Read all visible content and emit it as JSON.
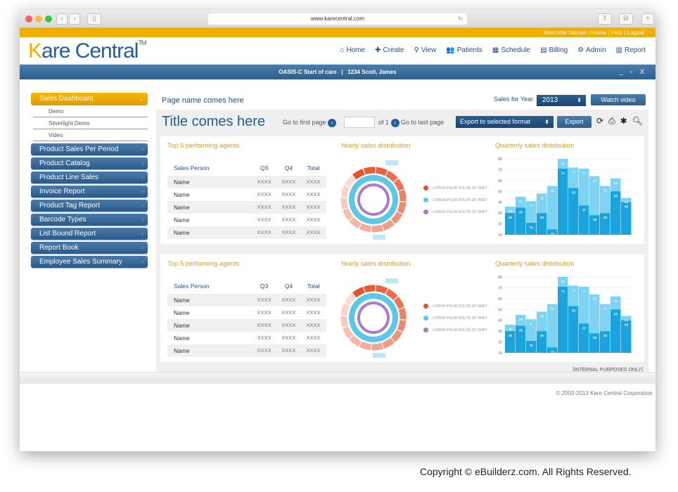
{
  "browser": {
    "url": "www.karecentral.com"
  },
  "topbar": {
    "welcome": "Welcome Naman",
    "links": [
      "Home",
      "Help",
      "Logout"
    ]
  },
  "logo": {
    "part1": "K",
    "part2": "are Central",
    "tm": "TM"
  },
  "nav": [
    {
      "icon": "home-icon",
      "glyph": "⌂",
      "label": "Home"
    },
    {
      "icon": "plus-icon",
      "glyph": "✚",
      "label": "Create"
    },
    {
      "icon": "search-icon",
      "glyph": "⚲",
      "label": "View"
    },
    {
      "icon": "users-icon",
      "glyph": "👥",
      "label": "Patients"
    },
    {
      "icon": "calendar-icon",
      "glyph": "▦",
      "label": "Schedule"
    },
    {
      "icon": "calculator-icon",
      "glyph": "▤",
      "label": "Billing"
    },
    {
      "icon": "gear-icon",
      "glyph": "⚙",
      "label": "Admin"
    },
    {
      "icon": "report-icon",
      "glyph": "▥",
      "label": "Report"
    }
  ],
  "context_bar": {
    "text": "OASIS-C Start of care   |   1234 Scott, James",
    "controls": "_ ▫ X"
  },
  "sidebar": {
    "active": "Sales Dashboard",
    "sub_items": [
      "Demo",
      "Silverlight Demo",
      "Video"
    ],
    "items": [
      "Product Sales Per Period",
      "Product Catalog",
      "Product Line Sales",
      "Invoice Report",
      "Product Tag Report",
      "Barcode Types",
      "List Bound Report",
      "Report Book",
      "Employee Sales Summary"
    ]
  },
  "page": {
    "name": "Page name comes here",
    "title": "Title comes here",
    "sales_for_year_label": "Sales for Year",
    "year": "2013",
    "watch_video": "Watch video"
  },
  "toolbar": {
    "first_page": "Go to first page",
    "of": "of 1",
    "last_page": "Go to last page",
    "export_select": "Export to selected format",
    "export": "Export"
  },
  "panels": [
    {
      "agents_title": "Top 5 performing agents",
      "yearly_title": "Yearly sales distribution",
      "quarterly_title": "Quarterly sales  distribution"
    },
    {
      "agents_title": "Top 5 performing agents",
      "yearly_title": "Yearly sales distribution",
      "quarterly_title": "Quarterly sales  distribution"
    }
  ],
  "table": {
    "headers": [
      "Sales Person",
      "Q3",
      "Q4",
      "Total"
    ],
    "rows": [
      [
        "Name",
        "XXXX",
        "XXXX",
        "XXXX"
      ],
      [
        "Name",
        "XXXX",
        "XXXX",
        "XXXX"
      ],
      [
        "Name",
        "XXXX",
        "XXXX",
        "XXXX"
      ],
      [
        "Name",
        "XXXX",
        "XXXX",
        "XXXX"
      ],
      [
        "Name",
        "XXXX",
        "XXXX",
        "XXXX"
      ]
    ]
  },
  "legend": [
    {
      "label": "LOREM IPSUM DOLOR SIT AMET",
      "color": "#e8502a"
    },
    {
      "label": "LOREM IPSUM DOLOR SIT AMET",
      "color": "#5bc8ea"
    },
    {
      "label": "LOREM IPSUM DOLOR SIT AMET",
      "color": "#a77bd0"
    }
  ],
  "chart_data": {
    "type": "bar",
    "yticks": [
      10,
      20,
      30,
      40,
      50,
      60,
      70,
      80
    ],
    "ylim": [
      10,
      80
    ],
    "series": [
      {
        "values": [
          30,
          35,
          21,
          30,
          15,
          71,
          53,
          37,
          28,
          30,
          50,
          40
        ],
        "color": "#1aa3dc"
      },
      {
        "values": [
          36,
          45,
          41,
          48,
          55,
          80,
          72,
          71,
          64,
          55,
          62,
          44
        ],
        "color": "#7fd3f2"
      }
    ]
  },
  "internal_note": "[INTERNAL PURPOSES ONLY]",
  "footer": {
    "copyright": "© 2003-2013 Kare Central Corporation"
  },
  "watermark": "Copyright © eBuilderz.com. All Rights Reserved."
}
